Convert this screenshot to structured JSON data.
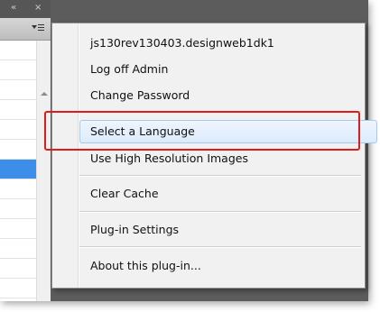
{
  "panel": {
    "titlebar_icons": {
      "collapse": "«",
      "close": "×"
    },
    "menu_icon": "panel-menu-icon"
  },
  "menu": {
    "items": [
      {
        "label": "js130rev130403.designweb1dk1"
      },
      {
        "label": "Log off Admin"
      },
      {
        "label": "Change Password"
      },
      {
        "label": "Select a Language"
      },
      {
        "label": "Use High Resolution Images"
      },
      {
        "label": "Clear Cache"
      },
      {
        "label": "Plug-in Settings"
      },
      {
        "label": "About this plug-in..."
      }
    ]
  },
  "colors": {
    "highlight_border": "#e01b1b",
    "selected_row": "#3d8ee8",
    "hover_bg": "#dcebfc"
  }
}
